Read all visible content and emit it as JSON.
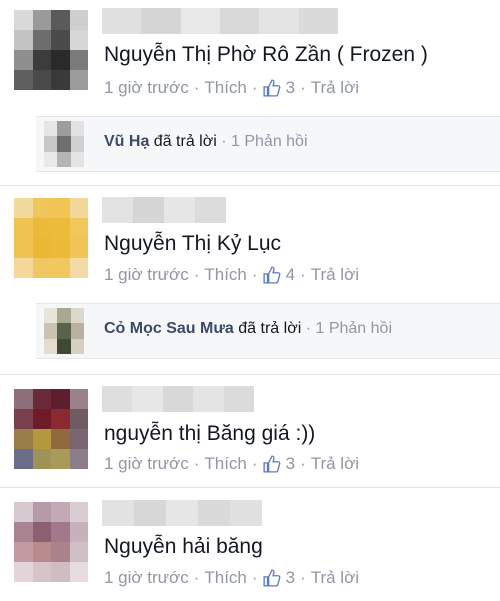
{
  "comments": [
    {
      "text": "Nguyễn Thị Phờ Rô Zần ( Frozen )",
      "time": "1 giờ trước",
      "like": "Thích",
      "likes": "3",
      "reply": "Trả lời",
      "sub": {
        "name": "Vũ Hạ",
        "action": "đã trả lời",
        "count": "1 Phản hồi"
      }
    },
    {
      "text": "Nguyễn Thị Kỷ Lục",
      "time": "1 giờ trước",
      "like": "Thích",
      "likes": "4",
      "reply": "Trả lời",
      "sub": {
        "name": "Cỏ Mọc Sau Mưa",
        "action": "đã trả lời",
        "count": "1 Phản hồi"
      }
    },
    {
      "text": "nguyễn thị Băng giá :))",
      "time": "1 giờ trước",
      "like": "Thích",
      "likes": "3",
      "reply": "Trả lời"
    },
    {
      "text": "Nguyễn hải băng",
      "time": "1 giờ trước",
      "like": "Thích",
      "likes": "3",
      "reply": "Trả lời"
    }
  ],
  "separator": "·",
  "colors": {
    "link": "#9197a3",
    "text": "#141823",
    "like_icon": "#5b7bc4",
    "reply_name": "#3b5998"
  },
  "icons": {
    "like": "thumbs-up-icon"
  }
}
